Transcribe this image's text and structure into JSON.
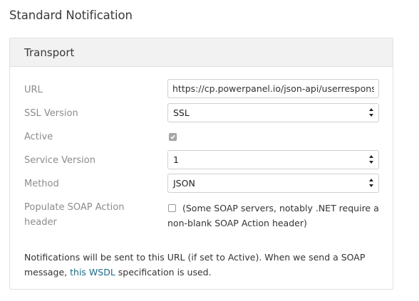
{
  "page": {
    "title": "Standard Notification"
  },
  "transport": {
    "title": "Transport",
    "url": {
      "label": "URL",
      "value": "https://cp.powerpanel.io/json-api/userresponse"
    },
    "ssl_version": {
      "label": "SSL Version",
      "value": "SSL"
    },
    "active": {
      "label": "Active",
      "checked": true
    },
    "service_version": {
      "label": "Service Version",
      "value": "1"
    },
    "method": {
      "label": "Method",
      "value": "JSON"
    },
    "populate_soap": {
      "label_line1": "Populate SOAP Action",
      "label_line2": "header",
      "checked": false,
      "note_line1": "(Some SOAP servers, notably .NET require a",
      "note_line2": "non-blank SOAP Action header)"
    },
    "footer": {
      "text_before": "Notifications will be sent to this URL (if set to Active). When we send a SOAP message, ",
      "link_text": "this WSDL",
      "text_after": " specification is used."
    }
  },
  "colors": {
    "link": "#1a6a8a",
    "label": "#8c8c8c",
    "header_bg": "#f2f2f2"
  }
}
